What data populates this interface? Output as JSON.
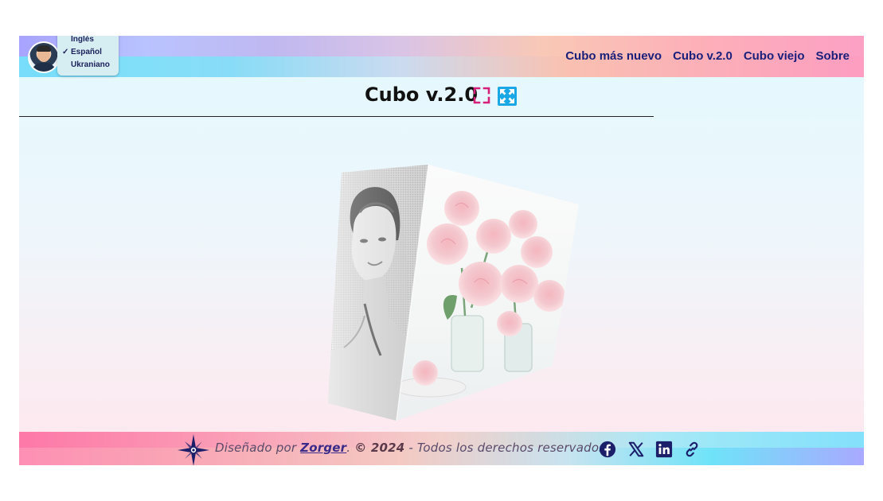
{
  "languages": {
    "items": [
      {
        "label": "Inglés",
        "selected": false
      },
      {
        "label": "Español",
        "selected": true
      },
      {
        "label": "Ukraniano",
        "selected": false
      }
    ],
    "check_mark": "✓"
  },
  "nav": {
    "items": [
      "Cubo más nuevo",
      "Cubo v.2.0",
      "Cubo viejo",
      "Sobre"
    ],
    "color": "#1a1f7a"
  },
  "main": {
    "title": "Cubo v.2.0",
    "icons": [
      "fullscreen-icon",
      "expand-arrows-icon"
    ],
    "icon_colors": {
      "fullscreen": "#d6207a",
      "expand": "#1aa7e6"
    }
  },
  "cube": {
    "faces": [
      "portrait-photo",
      "roses-photo"
    ]
  },
  "footer": {
    "prefix": "Diseñado por ",
    "author": "Zorger",
    "after_author": ". ",
    "copyright": "© 2024",
    "rights": " - Todos los derechos reservados",
    "social_icons": [
      "facebook-icon",
      "x-icon",
      "linkedin-icon",
      "link-icon"
    ],
    "icon_color": "#1b1f6a"
  }
}
